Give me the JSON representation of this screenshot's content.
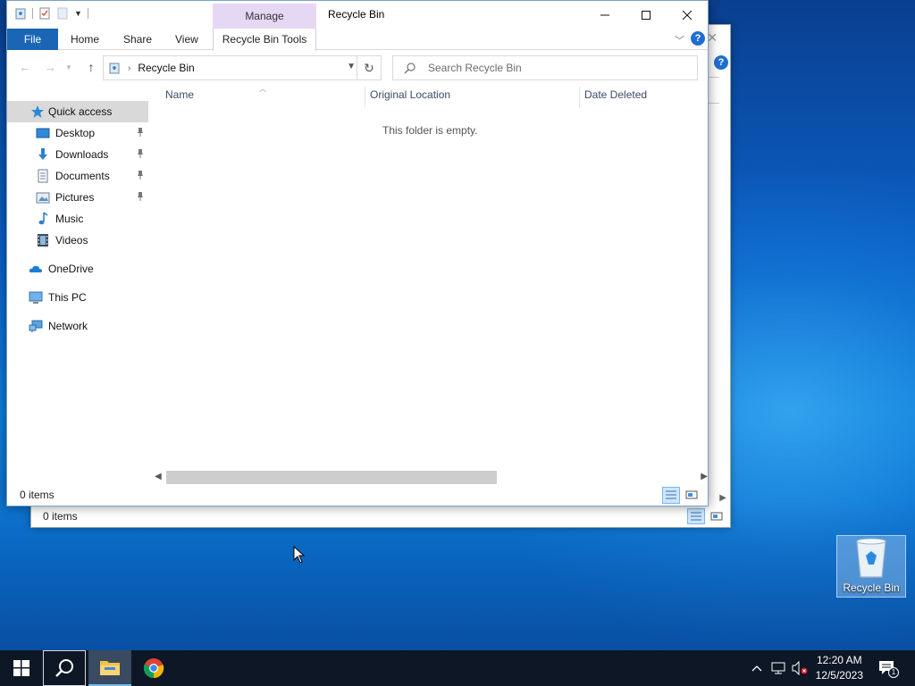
{
  "background_window": {
    "status_text": "0 items"
  },
  "window": {
    "title": "Recycle Bin",
    "context_tab_group": "Manage",
    "ribbon_tabs": {
      "file": "File",
      "home": "Home",
      "share": "Share",
      "view": "View",
      "tools": "Recycle Bin Tools"
    },
    "address": {
      "breadcrumb": "Recycle Bin"
    },
    "search": {
      "placeholder": "Search Recycle Bin"
    },
    "sidebar": {
      "items": [
        {
          "label": "Quick access",
          "pinned": false,
          "selected": true
        },
        {
          "label": "Desktop",
          "pinned": true
        },
        {
          "label": "Downloads",
          "pinned": true
        },
        {
          "label": "Documents",
          "pinned": true
        },
        {
          "label": "Pictures",
          "pinned": true
        },
        {
          "label": "Music",
          "pinned": false
        },
        {
          "label": "Videos",
          "pinned": false
        },
        {
          "label": "OneDrive",
          "pinned": false
        },
        {
          "label": "This PC",
          "pinned": false
        },
        {
          "label": "Network",
          "pinned": false
        }
      ]
    },
    "columns": [
      "Name",
      "Original Location",
      "Date Deleted"
    ],
    "empty_message": "This folder is empty.",
    "status_text": "0 items"
  },
  "desktop": {
    "icon_label": "Recycle Bin"
  },
  "taskbar": {
    "time": "12:20 AM",
    "date": "12/5/2023",
    "notification_count": "1"
  },
  "colors": {
    "file_tab": "#1a66b5",
    "manage_tab": "#e6d8f5",
    "taskbar": "#0d1726",
    "accent": "#1f6fd1"
  }
}
